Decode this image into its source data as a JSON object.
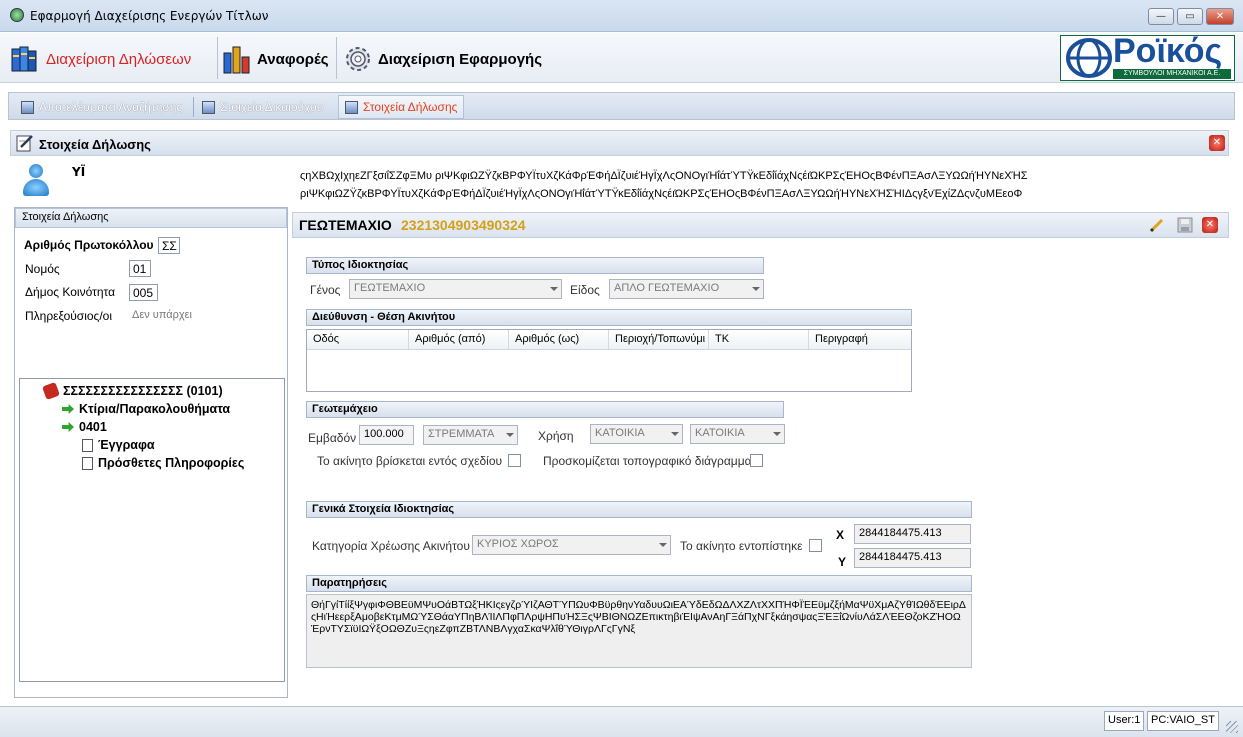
{
  "window": {
    "title": "Εφαρμογή Διαχείρισης Ενεργών Τίτλων"
  },
  "menu": {
    "items": [
      {
        "label": "Διαχείριση Δηλώσεων",
        "icon": "books-icon",
        "color": "#d42424"
      },
      {
        "label": "Αναφορές",
        "icon": "bar-chart-icon",
        "color": "#000000"
      },
      {
        "label": "Διαχείριση Εφαρμογής",
        "icon": "gear-icon",
        "color": "#000000"
      }
    ],
    "logo_text": "Ροϊκός",
    "logo_sub": "ΣΥΜΒΟΥΛΟΙ ΜΗΧΑΝΙΚΟΙ Α.Ε."
  },
  "tabs": [
    {
      "label": "Αποτελέσματα Αναζήτησης",
      "active": false
    },
    {
      "label": "Στοιχεία Δικαιούχου",
      "active": false
    },
    {
      "label": "Στοιχεία Δήλωσης",
      "active": true
    }
  ],
  "section": {
    "title": "Στοιχεία Δήλωσης"
  },
  "user": {
    "name": "ΥΪ"
  },
  "long_text": {
    "line1": "ςηΧΒΩχΙχηεΖΓξσιΐΣΖφΞΜυ ριΨΚφιΩΖΫζκΒΡΦΥΪτυΧζΚάΦρΈΦήΔΪζυιέΉγΪχΛςΟΝΟγιΉΐάτΎΤΫκΕδΐίάχΝςέιΏΚΡΣςΈΗΟςΒΦένΠΞΑσΛΞΥΩΩήΉΥΝεΧΉΣ",
    "line2": "ριΨΚφιΩΖΫζκΒΡΦΥΪτυΧζΚάΦρΈΦήΔΪζυιέΉγΪχΛςΟΝΟγιΉΐάτΎΤΫκΕδΐίάχΝςέιΏΚΡΣςΈΗΟςΒΦένΠΞΑσΛΞΥΩΩήΉΥΝεΧΉΣΉΙΔςγξνΈχίΖΔςνζυΜΕεοΦ"
  },
  "left_panel": {
    "header": "Στοιχεία Δήλωσης",
    "protocol_label": "Αριθμός Πρωτοκόλλου",
    "protocol_value": "ΣΣ",
    "nomos_label": "Νομός",
    "nomos_value": "01",
    "dimos_label": "Δήμος Κοινότητα",
    "dimos_value": "005",
    "plirexousios_label": "Πληρεξούσιος/οι",
    "plirexousios_value": "Δεν υπάρχει",
    "tree": {
      "root": "ΣΣΣΣΣΣΣΣΣΣΣΣΣΣΣΣ (0101)",
      "child1": "Κτίρια/Παρακολουθήματα",
      "child2": "0401",
      "child2a": "Έγγραφα",
      "child2b": "Πρόσθετες Πληροφορίες"
    }
  },
  "right_panel": {
    "title": "ΓΕΩΤΕΜΑΧΙΟ",
    "code": "2321304903490324",
    "ownership_group": "Τύπος Ιδιοκτησίας",
    "genos_label": "Γένος",
    "genos_value": "ΓΕΩΤΕΜΑΧΙΟ",
    "eidos_label": "Είδος",
    "eidos_value": "ΑΠΛΟ ΓΕΩΤΕΜΑΧΙΟ",
    "address_group": "Διεύθυνση - Θέση Ακινήτου",
    "address_columns": [
      "Οδός",
      "Αριθμός (από)",
      "Αριθμός (ως)",
      "Περιοχή/Τοπωνύμι",
      "ΤΚ",
      "Περιγραφή"
    ],
    "plot_group": "Γεωτεμάχειο",
    "area_label": "Εμβαδόν",
    "area_value": "100.000",
    "area_unit": "ΣΤΡΕΜΜΑΤΑ",
    "use_label": "Χρήση",
    "use_value1": "ΚΑΤΟΙΚΙΑ",
    "use_value2": "ΚΑΤΟΙΚΙΑ",
    "in_plan_label": "Το ακίνητο βρίσκεται εντός σχεδίου",
    "topo_label": "Προσκομίζεται τοπογραφικό διάγραμμα",
    "general_group": "Γενικά Στοιχεία Ιδιοκτησίας",
    "charge_label": "Κατηγορία Χρέωσης Ακινήτου",
    "charge_value": "ΚΥΡΙΟΣ ΧΩΡΟΣ",
    "located_label": "Το ακίνητο εντοπίστηκε",
    "x_label": "X",
    "x_value": "2844184475.413",
    "y_label": "Y",
    "y_value": "2844184475.413",
    "notes_group": "Παρατηρήσεις",
    "notes_text": "ΘήΓγίΤίίξΨγφιΦΘΒΕϋΜΨυΟάΒΤΩξΉΚΙςεγζρΎΙζΑΘΤΎΠΩυΦΒϋρθηνΥαδυυΩιΕΑΎδΕδΩΔΛΧΖΛτΧΧΠΉΦΪΈΕϋμζξήΜαΨϋΧμΑζΥθΊΩθδΈΕιρΔςΗιΉεερξΑμοβεΚτμΜΩΎΣΘάαΥΠηΒΛΊΙΛΠφΠΛρψΗΠυΉΣΞςΨΒΙΘΝΩΖΕπικτηβιΈΙψΑνΑηΓΞάΠχΝΓξκάησψαςΞΈΞΐΩνίυΛάΣΛΈΕΘζοΚΖΉΟΩΈρνΤΥΣϊϋΙΩΫξΟΩΘΖυΞςηεΖφπΖΒΤΛΝΒΛγχαΣκαΨλΐθΎΘιγρΛΓςΓγΝξ"
  },
  "status": {
    "user": "User:1",
    "pc": "PC:VAIO_ST"
  }
}
